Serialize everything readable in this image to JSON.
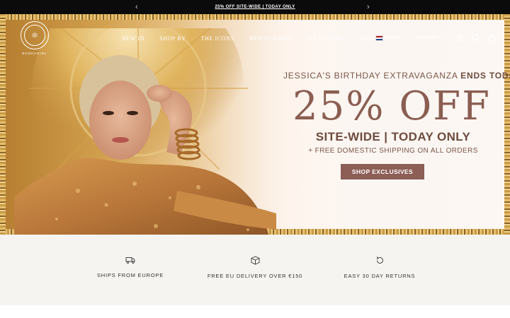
{
  "announcement": {
    "message": "25% OFF SITE-WIDE | TODAY ONLY",
    "prev_icon": "chevron-left-icon",
    "next_icon": "chevron-right-icon"
  },
  "header": {
    "logo_text": "BUDHAGIRL",
    "nav": [
      "NEW IN",
      "SHOP BY",
      "THE ICONS",
      "MINDFULNESS",
      "GRATITUDE",
      "ABOUT"
    ],
    "currency": "EUR €",
    "language": "ENGLISH",
    "icons": [
      "account-icon",
      "search-icon",
      "bag-icon"
    ]
  },
  "promo": {
    "eyebrow_start": "JESSICA'S BIRTHDAY EXTRAVAGANZA ",
    "eyebrow_emphasis": "ENDS TODAY",
    "headline": "25% OFF",
    "subheadline": "SITE-WIDE | TODAY ONLY",
    "shipping_note": "+ FREE DOMESTIC SHIPPING ON ALL ORDERS",
    "cta": "SHOP EXCLUSIVES"
  },
  "features": [
    {
      "icon": "truck-icon",
      "label": "SHIPS FROM EUROPE"
    },
    {
      "icon": "box-icon",
      "label": "FREE EU DELIVERY OVER €150"
    },
    {
      "icon": "return-icon",
      "label": "EASY 30 DAY RETURNS"
    }
  ],
  "colors": {
    "announcement_bg": "#0b0b0b",
    "cta_bg": "#8c5e55",
    "headline": "#8b5e52",
    "features_bg": "#f6f4f1"
  }
}
